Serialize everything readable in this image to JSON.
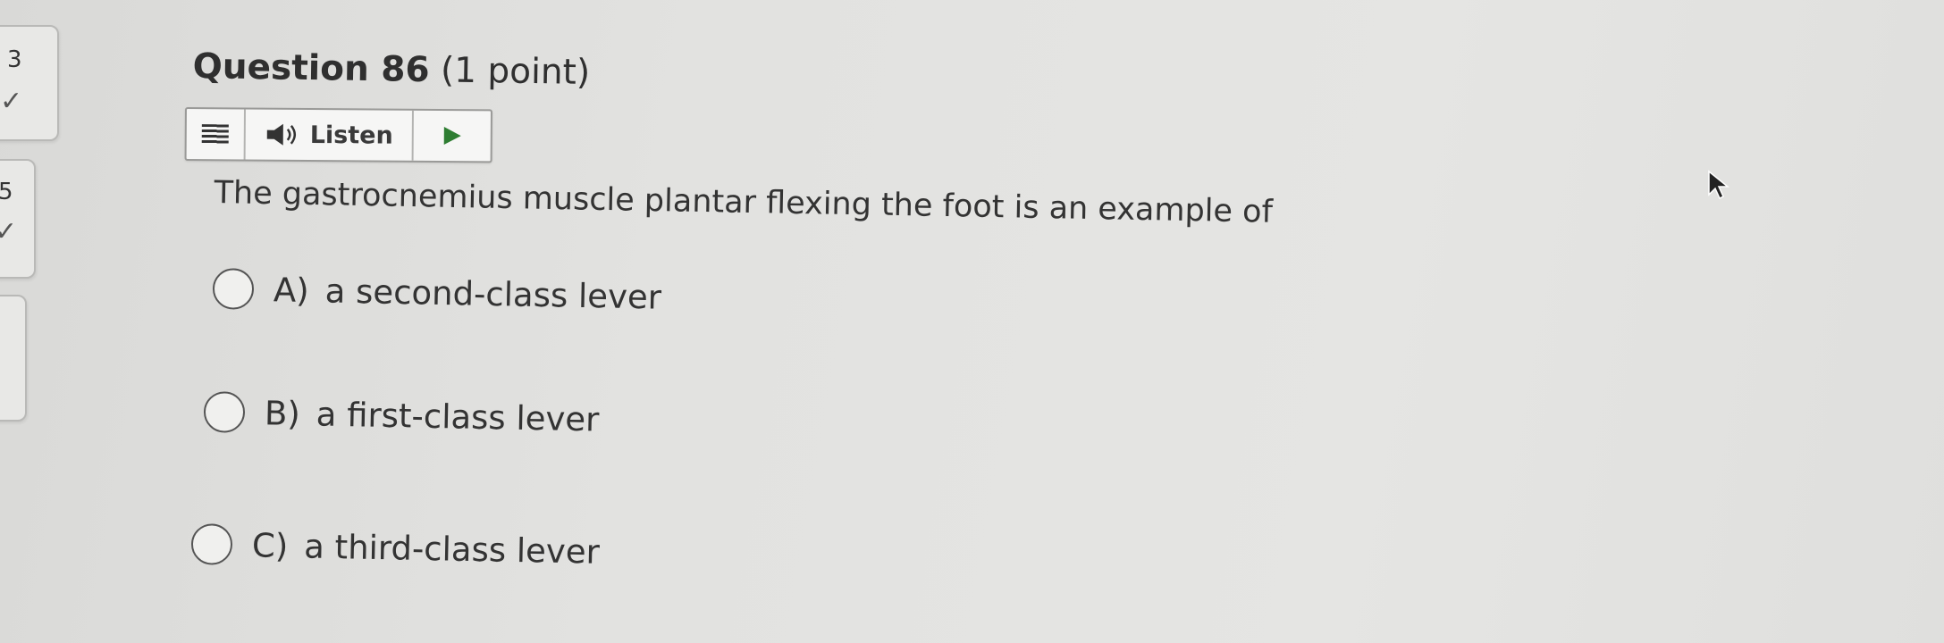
{
  "navigator": {
    "items": [
      {
        "number": "3",
        "status": "✓"
      },
      {
        "number": "5",
        "status": "✓"
      },
      {
        "number": "",
        "status": ""
      }
    ]
  },
  "question": {
    "name": "Question 86",
    "points": "(1 point)",
    "prompt": "The gastrocnemius muscle plantar flexing the foot is an example of"
  },
  "toolbar": {
    "menu_icon": "menu-lines-icon",
    "listen_icon": "speaker-icon",
    "listen_label": "Listen",
    "play_icon": "play-triangle-icon",
    "play_color": "#2e7d32"
  },
  "choices": [
    {
      "letter": "A)",
      "text": "a second-class lever"
    },
    {
      "letter": "B)",
      "text": "a first-class lever"
    },
    {
      "letter": "C)",
      "text": "a third-class lever"
    }
  ]
}
